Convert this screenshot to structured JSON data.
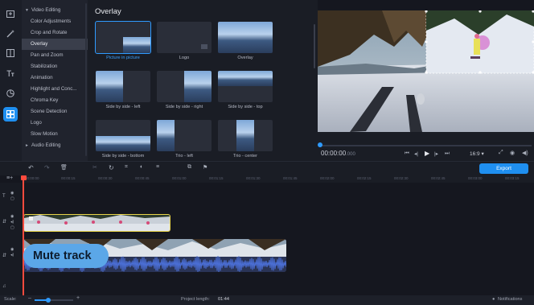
{
  "rail": {
    "icons": [
      "import-icon",
      "magic-wand-icon",
      "filters-icon",
      "titles-icon",
      "stickers-icon",
      "transitions-icon"
    ]
  },
  "categories": [
    {
      "label": "Video Editing",
      "group": true
    },
    {
      "label": "Color Adjustments",
      "group": false
    },
    {
      "label": "Crop and Rotate",
      "group": false
    },
    {
      "label": "Overlay",
      "group": false,
      "selected": true
    },
    {
      "label": "Pan and Zoom",
      "group": false
    },
    {
      "label": "Stabilization",
      "group": false
    },
    {
      "label": "Animation",
      "group": false
    },
    {
      "label": "Highlight and Conc...",
      "group": false
    },
    {
      "label": "Chroma Key",
      "group": false
    },
    {
      "label": "Scene Detection",
      "group": false
    },
    {
      "label": "Logo",
      "group": false
    },
    {
      "label": "Slow Motion",
      "group": false
    },
    {
      "label": "Audio Editing",
      "group": true
    }
  ],
  "panel": {
    "title": "Overlay",
    "tiles": [
      {
        "label": "Picture in picture",
        "selected": true
      },
      {
        "label": "Logo"
      },
      {
        "label": "Overlay"
      },
      {
        "label": "Side by side - left"
      },
      {
        "label": "Side by side - right"
      },
      {
        "label": "Side by side - top"
      },
      {
        "label": "Side by side - bottom"
      },
      {
        "label": "Trio - left"
      },
      {
        "label": "Trio - center"
      }
    ]
  },
  "player": {
    "timecode": "00:00:00",
    "timecode_ms": ".000",
    "aspect": "16:9"
  },
  "toolbar": {
    "export_label": "Export"
  },
  "ruler": {
    "ticks": [
      "00:00:00",
      "00:00:15",
      "00:00:30",
      "00:00:45",
      "00:01:00",
      "00:01:15",
      "00:01:30",
      "00:01:45",
      "00:02:00",
      "00:02:15",
      "00:02:30",
      "00:02:45",
      "00:03:00",
      "00:03:15"
    ]
  },
  "timeline": {
    "tooltip": "Mute track"
  },
  "status": {
    "scale_label": "Scale:",
    "project_length_label": "Project length:",
    "project_length": "01:44",
    "notifications": "Notifications",
    "scale_level": 0.35
  },
  "colors": {
    "accent": "#1f8ff0",
    "playhead": "#ff4b3e",
    "overlay_clip_border": "#e7d34a",
    "audio_wave": "#4b6fd6"
  }
}
